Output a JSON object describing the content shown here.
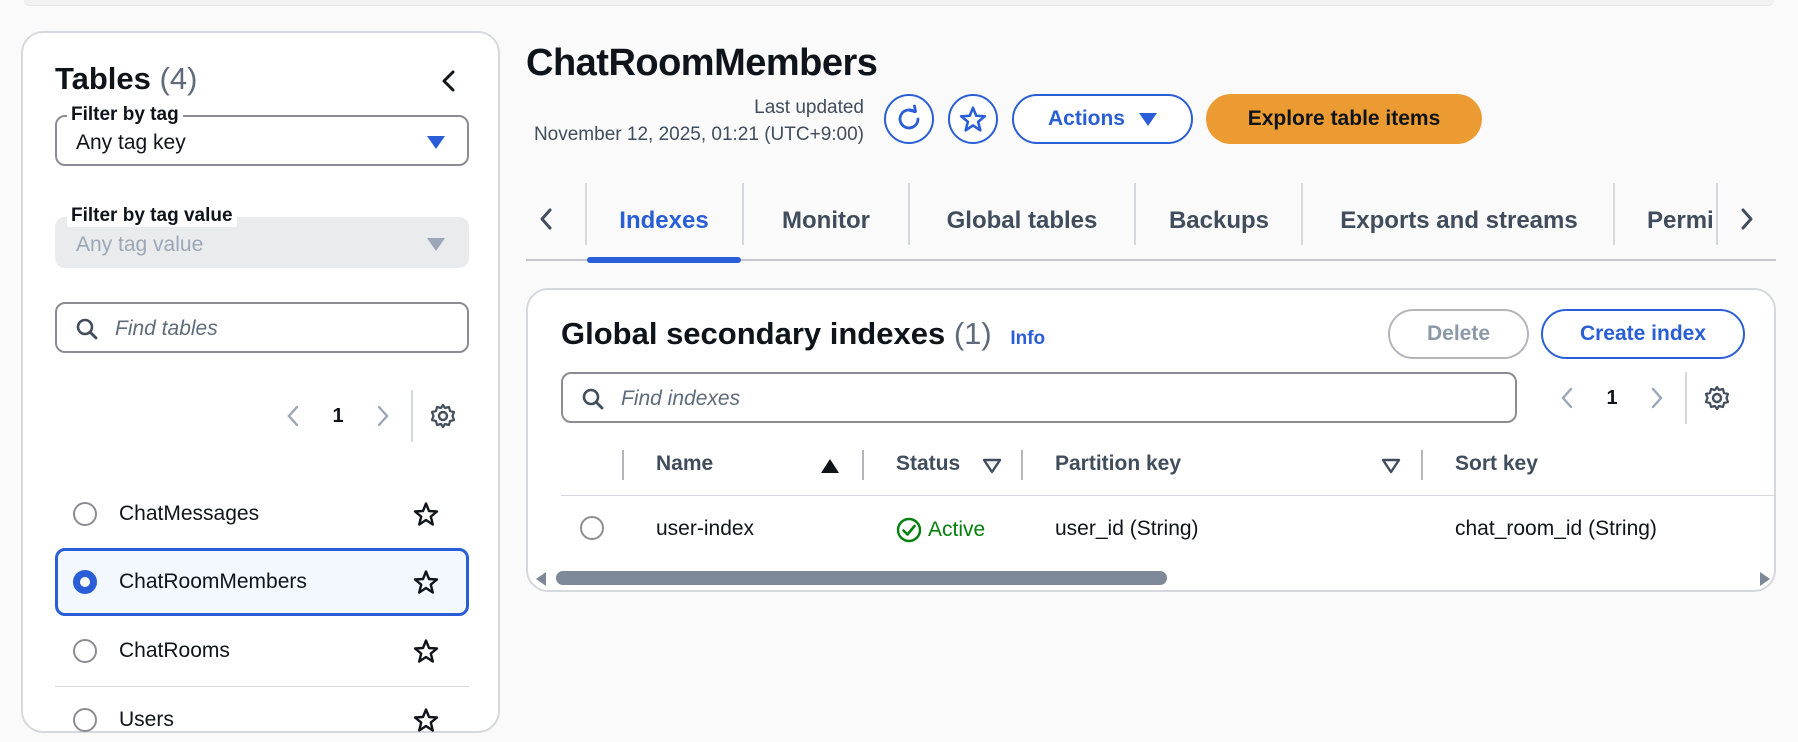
{
  "sidebar": {
    "title": "Tables",
    "count": "(4)",
    "filter_tag": {
      "label": "Filter by tag",
      "value": "Any tag key"
    },
    "filter_value": {
      "label": "Filter by tag value",
      "value": "Any tag value"
    },
    "search": {
      "placeholder": "Find tables"
    },
    "page": "1",
    "tables": [
      {
        "name": "ChatMessages",
        "selected": false
      },
      {
        "name": "ChatRoomMembers",
        "selected": true
      },
      {
        "name": "ChatRooms",
        "selected": false
      },
      {
        "name": "Users",
        "selected": false
      }
    ]
  },
  "header": {
    "title": "ChatRoomMembers",
    "last_updated_label": "Last updated",
    "last_updated_value": "November 12, 2025, 01:21 (UTC+9:00)",
    "actions_label": "Actions",
    "explore_label": "Explore table items"
  },
  "tabs": [
    "Indexes",
    "Monitor",
    "Global tables",
    "Backups",
    "Exports and streams",
    "Permi"
  ],
  "active_tab": "Indexes",
  "gsi": {
    "title": "Global secondary indexes",
    "count": "(1)",
    "info": "Info",
    "delete_label": "Delete",
    "create_label": "Create index",
    "search_placeholder": "Find indexes",
    "page": "1",
    "columns": [
      "Name",
      "Status",
      "Partition key",
      "Sort key"
    ],
    "rows": [
      {
        "name": "user-index",
        "status": "Active",
        "partition_key": "user_id (String)",
        "sort_key": "chat_room_id (String)"
      }
    ]
  },
  "colors": {
    "accent": "#295ed6",
    "primary_button": "#eb9b32",
    "status_active": "#037f0c"
  }
}
